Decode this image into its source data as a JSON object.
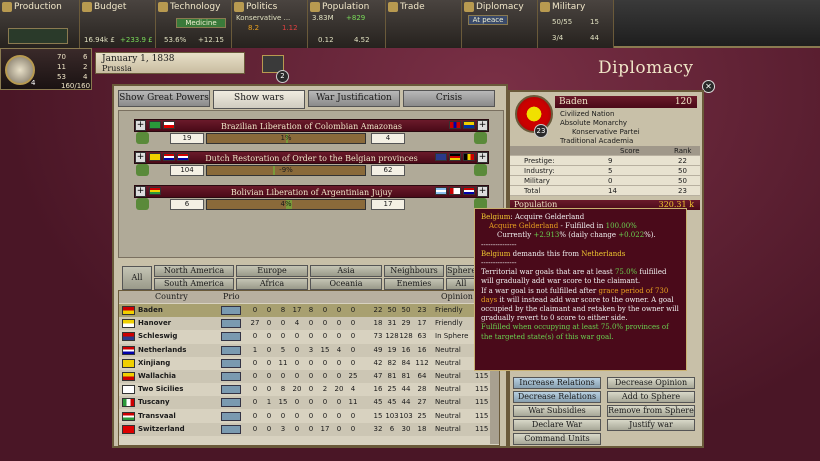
{
  "topbar": {
    "production": {
      "title": "Production"
    },
    "budget": {
      "title": "Budget",
      "value": "16.94k £",
      "change": "+233.9 £"
    },
    "technology": {
      "title": "Technology",
      "research": "Medicine",
      "pct": "53.6%",
      "points": "+12.15"
    },
    "politics": {
      "title": "Politics",
      "party": "Konservative ...",
      "v1": "8.2",
      "v2": "1.12"
    },
    "population": {
      "title": "Population",
      "total": "3.83M",
      "growth": "+829",
      "v1": "0.12",
      "v2": "4.52"
    },
    "trade": {
      "title": "Trade"
    },
    "diplomacy": {
      "title": "Diplomacy",
      "status": "At peace"
    },
    "military": {
      "title": "Military",
      "v1": "50/55",
      "v2": "15",
      "v3": "3/4",
      "v4": "44"
    }
  },
  "country": {
    "prestige": "70",
    "p_rank": "6",
    "industry": "11",
    "i_rank": "2",
    "military": "53",
    "m_rank": "4",
    "rank": "4",
    "leadership": "160/160"
  },
  "date": "January 1, 1838",
  "speed": "Prussia",
  "message_count": "2",
  "page_title": "Diplomacy",
  "tabs": [
    "Show Great Powers",
    "Show wars",
    "War Justification",
    "Crisis"
  ],
  "wars": [
    {
      "name": "Brazilian Liberation of Colombian Amazonas",
      "att": "19",
      "def": "4",
      "pct": "1%",
      "fill": 0.01
    },
    {
      "name": "Dutch Restoration of Order to the Belgian provinces",
      "att": "104",
      "def": "62",
      "pct": "-9%",
      "fill": 0.0
    },
    {
      "name": "Bolivian Liberation of Argentinian Jujuy",
      "att": "6",
      "def": "17",
      "pct": "4%",
      "fill": 0.04
    }
  ],
  "filters": {
    "all": "All",
    "regions": [
      "North America",
      "South America",
      "Europe",
      "Africa",
      "Asia",
      "Oceania"
    ],
    "groups": [
      "Neighbours",
      "Enemies",
      "Sphere",
      "All"
    ]
  },
  "list_headers": {
    "country": "Country",
    "prio": "Prio",
    "opinion": "Opinion"
  },
  "countries": [
    {
      "name": "Baden",
      "a": "0",
      "b": "0",
      "c": "8",
      "d": "17",
      "e": "8",
      "f": "0",
      "g": "0",
      "h": "0",
      "r1": "22",
      "r2": "50",
      "r3": "50",
      "r4": "23",
      "opinion": "Friendly",
      "o2": ""
    },
    {
      "name": "Hanover",
      "a": "27",
      "b": "0",
      "c": "0",
      "d": "4",
      "e": "0",
      "f": "0",
      "g": "0",
      "h": "0",
      "r1": "18",
      "r2": "31",
      "r3": "29",
      "r4": "17",
      "opinion": "Friendly",
      "o2": ""
    },
    {
      "name": "Schleswig",
      "a": "0",
      "b": "0",
      "c": "0",
      "d": "0",
      "e": "0",
      "f": "0",
      "g": "0",
      "h": "0",
      "r1": "73",
      "r2": "128",
      "r3": "128",
      "r4": "63",
      "opinion": "In Sphere",
      "o2": ""
    },
    {
      "name": "Netherlands",
      "a": "1",
      "b": "0",
      "c": "5",
      "d": "0",
      "e": "3",
      "f": "15",
      "g": "4",
      "h": "0",
      "r1": "49",
      "r2": "19",
      "r3": "16",
      "r4": "16",
      "opinion": "Neutral",
      "o2": ""
    },
    {
      "name": "Xinjiang",
      "a": "0",
      "b": "0",
      "c": "11",
      "d": "0",
      "e": "0",
      "f": "0",
      "g": "0",
      "h": "0",
      "r1": "42",
      "r2": "82",
      "r3": "84",
      "r4": "112",
      "opinion": "Neutral",
      "o2": ""
    },
    {
      "name": "Wallachia",
      "a": "0",
      "b": "0",
      "c": "0",
      "d": "0",
      "e": "0",
      "f": "0",
      "g": "0",
      "h": "25",
      "r1": "47",
      "r2": "81",
      "r3": "81",
      "r4": "64",
      "opinion": "Neutral",
      "o2": "115"
    },
    {
      "name": "Two Sicilies",
      "a": "0",
      "b": "0",
      "c": "8",
      "d": "20",
      "e": "0",
      "f": "2",
      "g": "20",
      "h": "4",
      "r1": "16",
      "r2": "25",
      "r3": "44",
      "r4": "28",
      "opinion": "Neutral",
      "o2": "115"
    },
    {
      "name": "Tuscany",
      "a": "0",
      "b": "1",
      "c": "15",
      "d": "0",
      "e": "0",
      "f": "0",
      "g": "0",
      "h": "11",
      "r1": "45",
      "r2": "45",
      "r3": "44",
      "r4": "27",
      "opinion": "Neutral",
      "o2": "115"
    },
    {
      "name": "Transvaal",
      "a": "0",
      "b": "0",
      "c": "0",
      "d": "0",
      "e": "0",
      "f": "0",
      "g": "0",
      "h": "0",
      "r1": "15",
      "r2": "103",
      "r3": "103",
      "r4": "25",
      "opinion": "Neutral",
      "o2": "115"
    },
    {
      "name": "Switzerland",
      "a": "0",
      "b": "0",
      "c": "3",
      "d": "0",
      "e": "0",
      "f": "17",
      "g": "0",
      "h": "0",
      "r1": "32",
      "r2": "6",
      "r3": "30",
      "r4": "18",
      "opinion": "Neutral",
      "o2": "115"
    }
  ],
  "selected_country": {
    "name": "Baden",
    "rank": "120",
    "circle_rank": "23",
    "lines": [
      "Civilized Nation",
      "Absolute Monarchy",
      "Konservative Partei",
      "Traditional Academia"
    ],
    "score_header": "Score",
    "rank_header": "Rank",
    "stats": [
      {
        "label": "Prestige:",
        "score": "9",
        "rank": "22"
      },
      {
        "label": "Industry:",
        "score": "5",
        "rank": "50"
      },
      {
        "label": "Military",
        "score": "0",
        "rank": "50"
      },
      {
        "label": "Total",
        "score": "14",
        "rank": "23"
      }
    ],
    "population_label": "Population",
    "population_value": "320.31 k"
  },
  "actions": [
    {
      "left": "Increase Relations",
      "right": "Decrease Opinion"
    },
    {
      "left": "Decrease Relations",
      "right": "Add to Sphere"
    },
    {
      "left": "War Subsidies",
      "right": "Remove from Sphere"
    },
    {
      "left": "Declare War",
      "right": "Justify war"
    },
    {
      "left": "Command Units",
      "right": ""
    }
  ],
  "tooltip": {
    "title_country": "Belgium",
    "title_rest": ": Acquire Gelderland",
    "goal": "Acquire Gelderland",
    "goal_rest": " - Fulfilled in ",
    "goal_pct": "100.00%",
    "currently": "Currently ",
    "cur_val": "+2.913",
    "cur_rest": "% (daily change ",
    "daily": "+0.022",
    "daily_rest": "%).",
    "sep": "---------------",
    "demand_country": "Belgium",
    "demand_rest": " demands this from ",
    "demand_target": "Netherlands",
    "sep2": "---------------",
    "p1a": "Territorial war goals that are at least ",
    "p1pct": "75.0%",
    "p1b": " fulfilled will gradually add war score to the claimant.",
    "p2a": "If a war goal is not fulfilled after ",
    "p2grace": "grace period of 730 days",
    "p2b": " it will instead add war score to the owner. A goal occupied by the claimant and retaken by the owner will gradually revert to 0 score to either side.",
    "p3": "Fulfilled when occupying at least 75.0% provinces of the targeted state(s) of this war goal."
  }
}
